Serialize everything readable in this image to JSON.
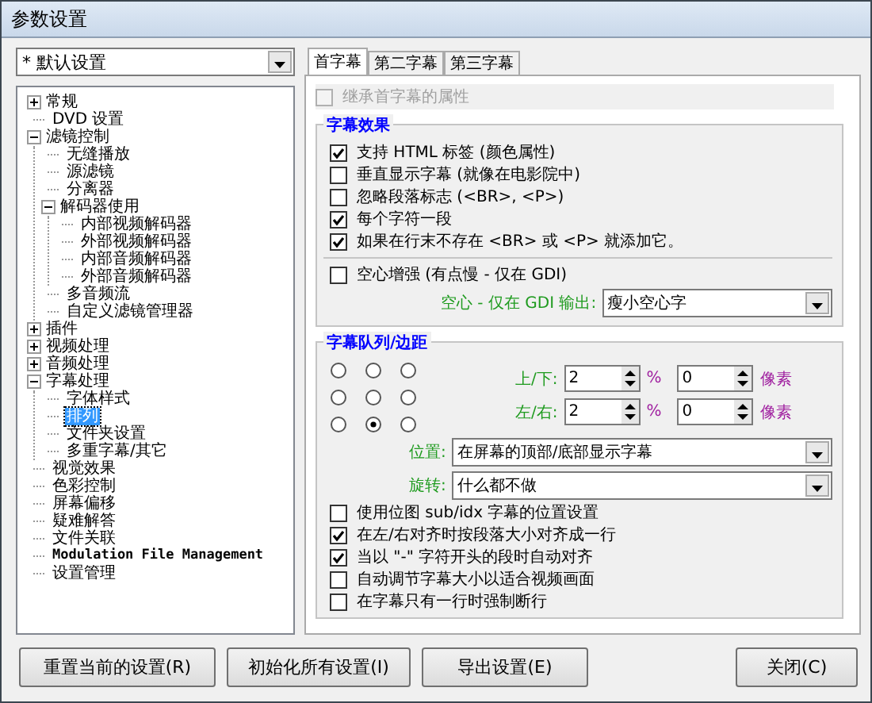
{
  "window": {
    "title": "参数设置"
  },
  "profile": {
    "value": "* 默认设置"
  },
  "tree": [
    {
      "label": "常规",
      "kind": "folder",
      "expanded": false,
      "selected": false
    },
    {
      "label": "DVD 设置",
      "kind": "leaf",
      "selected": false
    },
    {
      "label": "滤镜控制",
      "kind": "folder",
      "expanded": true,
      "selected": false,
      "children": [
        {
          "label": "无缝播放",
          "kind": "leaf",
          "selected": false
        },
        {
          "label": "源滤镜",
          "kind": "leaf",
          "selected": false
        },
        {
          "label": "分离器",
          "kind": "leaf",
          "selected": false
        },
        {
          "label": "解码器使用",
          "kind": "folder",
          "expanded": true,
          "selected": false,
          "children": [
            {
              "label": "内部视频解码器",
              "kind": "leaf",
              "selected": false
            },
            {
              "label": "外部视频解码器",
              "kind": "leaf",
              "selected": false
            },
            {
              "label": "内部音频解码器",
              "kind": "leaf",
              "selected": false
            },
            {
              "label": "外部音频解码器",
              "kind": "leaf",
              "selected": false
            }
          ]
        },
        {
          "label": "多音频流",
          "kind": "leaf",
          "selected": false
        },
        {
          "label": "自定义滤镜管理器",
          "kind": "leaf",
          "selected": false
        }
      ]
    },
    {
      "label": "插件",
      "kind": "folder",
      "expanded": false,
      "selected": false
    },
    {
      "label": "视频处理",
      "kind": "folder",
      "expanded": false,
      "selected": false
    },
    {
      "label": "音频处理",
      "kind": "folder",
      "expanded": false,
      "selected": false
    },
    {
      "label": "字幕处理",
      "kind": "folder",
      "expanded": true,
      "selected": false,
      "children": [
        {
          "label": "字体样式",
          "kind": "leaf",
          "selected": false
        },
        {
          "label": "排列",
          "kind": "leaf",
          "selected": true
        },
        {
          "label": "文件夹设置",
          "kind": "leaf",
          "selected": false
        },
        {
          "label": "多重字幕/其它",
          "kind": "leaf",
          "selected": false
        }
      ]
    },
    {
      "label": "视觉效果",
      "kind": "leaf",
      "selected": false
    },
    {
      "label": "色彩控制",
      "kind": "leaf",
      "selected": false
    },
    {
      "label": "屏幕偏移",
      "kind": "leaf",
      "selected": false
    },
    {
      "label": "疑难解答",
      "kind": "leaf",
      "selected": false
    },
    {
      "label": "文件关联",
      "kind": "leaf",
      "selected": false
    },
    {
      "label": "Modulation File Management",
      "kind": "leaf",
      "selected": false
    },
    {
      "label": "设置管理",
      "kind": "leaf",
      "selected": false
    }
  ],
  "tabs": [
    {
      "label": "首字幕",
      "selected": true
    },
    {
      "label": "第二字幕",
      "selected": false
    },
    {
      "label": "第三字幕",
      "selected": false
    }
  ],
  "inherit": {
    "label": "继承首字幕的属性",
    "checked": false,
    "disabled": true
  },
  "effects": {
    "title": "字幕效果",
    "options": [
      {
        "label": "支持 HTML 标签 (颜色属性)",
        "checked": true
      },
      {
        "label": "垂直显示字幕 (就像在电影院中)",
        "checked": false
      },
      {
        "label": "忽略段落标志 (<BR>, <P>)",
        "checked": false
      },
      {
        "label": "每个字符一段",
        "checked": true
      },
      {
        "label": "如果在行末不存在 <BR> 或 <P> 就添加它。",
        "checked": true
      }
    ],
    "hollow": {
      "label": "空心增强 (有点慢 - 仅在 GDI)",
      "checked": false
    },
    "hollow_output": {
      "label": "空心 - 仅在 GDI 输出:",
      "value": "瘦小空心字"
    }
  },
  "alignment": {
    "title": "字幕队列/边距",
    "radios": [
      {
        "selected": false
      },
      {
        "selected": false
      },
      {
        "selected": false
      },
      {
        "selected": false
      },
      {
        "selected": false
      },
      {
        "selected": false
      },
      {
        "selected": false
      },
      {
        "selected": true
      },
      {
        "selected": false
      }
    ],
    "margins": [
      {
        "label": "上/下:",
        "percent": "2",
        "percent_unit": "%",
        "pixels": "0",
        "pixel_unit": "像素"
      },
      {
        "label": "左/右:",
        "percent": "2",
        "percent_unit": "%",
        "pixels": "0",
        "pixel_unit": "像素"
      }
    ],
    "position": {
      "label": "位置:",
      "value": "在屏幕的顶部/底部显示字幕"
    },
    "rotation": {
      "label": "旋转:",
      "value": "什么都不做"
    },
    "options": [
      {
        "label": "使用位图 sub/idx 字幕的位置设置",
        "checked": false
      },
      {
        "label": "在左/右对齐时按段落大小对齐成一行",
        "checked": true
      },
      {
        "label": "当以 \"-\" 字符开头的段时自动对齐",
        "checked": true
      },
      {
        "label": "自动调节字幕大小以适合视频画面",
        "checked": false
      },
      {
        "label": "在字幕只有一行时强制断行",
        "checked": false
      }
    ]
  },
  "buttons": [
    "重置当前的设置(R)",
    "初始化所有设置(I)",
    "导出设置(E)",
    "关闭(C)"
  ]
}
